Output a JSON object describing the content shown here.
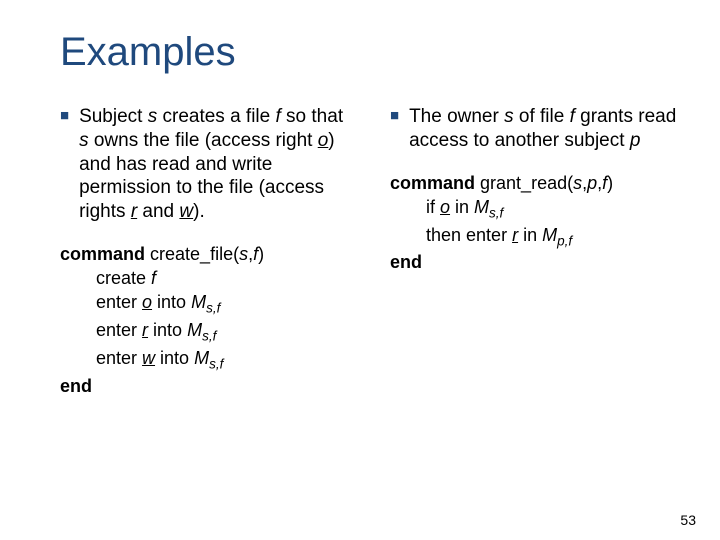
{
  "title": "Examples",
  "left": {
    "bullet": {
      "t1": "Subject ",
      "s1": "s",
      "t2": " creates a file ",
      "f": "f",
      "t3": " so that ",
      "s2": "s",
      "t4": " owns the file (access right ",
      "o": "o",
      "t5": ") and has read and write permission to the file (access rights ",
      "r": "r",
      "t6": " and  ",
      "w": "w",
      "t7": ")."
    },
    "code": {
      "cmd": "command",
      "name": " create_file(",
      "arg_s": "s",
      "comma": ",",
      "arg_f": "f",
      "close": ")",
      "l1a": "create ",
      "l1b": "f",
      "enter": "enter ",
      "o": "o",
      "into": "  into ",
      "M": "M",
      "sub_sf": "s,f",
      "r": "r",
      "into2": " into ",
      "w": "w",
      "end": "end"
    }
  },
  "right": {
    "bullet": {
      "t1": "The owner ",
      "s": "s",
      "t2": " of file ",
      "f": "f",
      "t3": " grants read access to another subject ",
      "p": "p"
    },
    "code": {
      "cmd": "command",
      "name": " grant_read(",
      "arg_s": "s",
      "c1": ",",
      "arg_p": "p",
      "c2": ",",
      "arg_f": "f",
      "close": ")",
      "if": "if ",
      "o": "o",
      "in": " in ",
      "M": "M",
      "sub_sf": "s,f",
      "then": "then enter ",
      "r": "r",
      "in2": " in ",
      "sub_pf": "p,f",
      "end": "end"
    }
  },
  "pagenum": "53"
}
